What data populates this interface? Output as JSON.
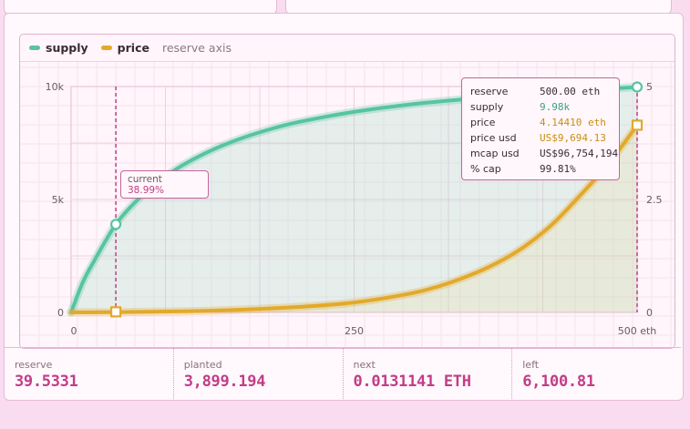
{
  "colors": {
    "supply": "#57c4a0",
    "price": "#e2a92b",
    "accent": "#c23d86",
    "grid": "#ecd2e0"
  },
  "legend": {
    "supply": "supply",
    "price": "price",
    "note": "reserve axis"
  },
  "chart_data": {
    "type": "line",
    "x_ticks": [
      0,
      250,
      500
    ],
    "x_tick_labels": [
      "0",
      "250",
      "500 eth"
    ],
    "xlim": [
      0,
      500
    ],
    "left_axis": {
      "ticks": [
        0,
        5000,
        10000
      ],
      "tick_labels": [
        "0",
        "5k",
        "10k"
      ],
      "ylim": [
        0,
        10000
      ]
    },
    "right_axis": {
      "ticks": [
        0,
        2.5,
        5
      ],
      "tick_labels": [
        "0",
        "2.5",
        "5"
      ],
      "ylim": [
        0,
        5
      ]
    },
    "series": [
      {
        "name": "supply",
        "axis": "left",
        "x": [
          0,
          10,
          20,
          39.53,
          60,
          80,
          100,
          125,
          150,
          175,
          200,
          250,
          300,
          350,
          400,
          450,
          500
        ],
        "y": [
          0,
          1300,
          2250,
          3899,
          5050,
          5900,
          6560,
          7200,
          7700,
          8100,
          8420,
          8880,
          9210,
          9450,
          9650,
          9820,
          9980
        ]
      },
      {
        "name": "price",
        "axis": "right",
        "x": [
          0,
          39.53,
          100,
          150,
          200,
          250,
          300,
          325,
          350,
          375,
          400,
          425,
          450,
          475,
          500
        ],
        "y": [
          0,
          0.006,
          0.025,
          0.06,
          0.12,
          0.22,
          0.42,
          0.58,
          0.8,
          1.08,
          1.45,
          1.95,
          2.6,
          3.3,
          4.1441
        ]
      }
    ],
    "markers": [
      {
        "series": "supply",
        "x": 39.53,
        "y": 3899
      },
      {
        "series": "price",
        "x": 39.53,
        "y": 0.0131
      },
      {
        "series": "supply",
        "x": 500,
        "y": 9980
      },
      {
        "series": "price",
        "x": 500,
        "y": 4.1441
      }
    ],
    "current_x": 39.53,
    "hover_x": 500
  },
  "callout": {
    "label": "current",
    "value": "38.99%"
  },
  "tooltip": [
    {
      "label": "reserve",
      "value": "500.00 eth",
      "color": "#3b2a33"
    },
    {
      "label": "supply",
      "value": "9.98k",
      "color": "#3aa37f"
    },
    {
      "label": "price",
      "value": "4.14410 eth",
      "color": "#c98e12"
    },
    {
      "label": "price usd",
      "value": "US$9,694.13",
      "color": "#c98e12"
    },
    {
      "label": "mcap usd",
      "value": "US$96,754,194",
      "color": "#3b2a33"
    },
    {
      "label": "% cap",
      "value": "99.81%",
      "color": "#3b2a33"
    }
  ],
  "stats": [
    {
      "label": "reserve",
      "value": "39.5331"
    },
    {
      "label": "planted",
      "value": "3,899.194"
    },
    {
      "label": "next",
      "value": "0.0131141 ETH"
    },
    {
      "label": "left",
      "value": "6,100.81"
    }
  ]
}
